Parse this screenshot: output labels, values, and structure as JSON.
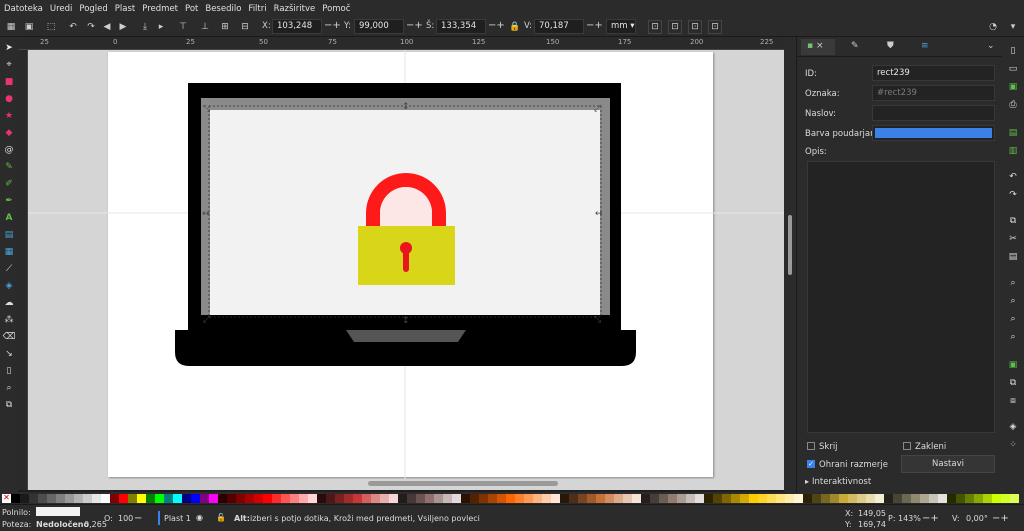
{
  "menu": [
    "Datoteka",
    "Uredi",
    "Pogled",
    "Plast",
    "Predmet",
    "Pot",
    "Besedilo",
    "Filtri",
    "Razširitve",
    "Pomoč"
  ],
  "coords": {
    "x_label": "X:",
    "x_value": "103,248",
    "y_label": "Y:",
    "y_value": "99,000",
    "w_label": "Š:",
    "w_value": "133,354",
    "h_label": "V:",
    "h_value": "70,187",
    "unit": "mm"
  },
  "ruler_marks": [
    "25",
    "0",
    "25",
    "50",
    "75",
    "100",
    "125",
    "150",
    "175",
    "200",
    "225"
  ],
  "panel": {
    "id_label": "ID:",
    "id_value": "rect239",
    "label_label": "Oznaka:",
    "label_placeholder": "#rect239",
    "title_label": "Naslov:",
    "title_value": "",
    "highlight_label": "Barva poudarjanja:",
    "highlight_color": "#3b82e8",
    "desc_label": "Opis:",
    "hide_label": "Skrij",
    "lock_label": "Zakleni",
    "keep_ratio_label": "Ohrani razmerje",
    "set_button": "Nastavi",
    "interactivity_label": "Interaktivnost"
  },
  "status": {
    "fill_label": "Polnilo:",
    "stroke_label": "Poteza:",
    "stroke_value": "Nedoločeno",
    "stroke_width": "0,265",
    "opacity_label": "O:",
    "opacity_value": "100",
    "layer": "Plast 1",
    "message_bold": "Alt:",
    "message": " izberi s potjo dotika, Kroži med predmeti, Vsiljeno povleci",
    "x_label": "X:",
    "x_value": "149,05",
    "y_label": "Y:",
    "y_value": "169,74",
    "zoom_label": "P:",
    "zoom_value": "143%",
    "rot_label": "V:",
    "rot_value": "0,00°"
  },
  "colors": {
    "laptop": "#000000",
    "screen_bezel": "#8a8a8a",
    "screen": "#f2f2f2",
    "shackle": "#ff1a1a",
    "lock_body": "#d9d61a",
    "keyhole": "#e8161c",
    "trackpad": "#555555"
  },
  "palette": [
    "#000000",
    "#1a1a1a",
    "#333333",
    "#4d4d4d",
    "#666666",
    "#808080",
    "#999999",
    "#b3b3b3",
    "#cccccc",
    "#e6e6e6",
    "#ffffff",
    "#800000",
    "#ff0000",
    "#808000",
    "#ffff00",
    "#008000",
    "#00ff00",
    "#008080",
    "#00ffff",
    "#000080",
    "#0000ff",
    "#800080",
    "#ff00ff",
    "#2b0000",
    "#550000",
    "#800000",
    "#aa0000",
    "#d40000",
    "#ff0000",
    "#ff2a2a",
    "#ff5555",
    "#ff8080",
    "#ffaaaa",
    "#ffd5d5",
    "#280b0b",
    "#501616",
    "#782121",
    "#a02c2c",
    "#c83737",
    "#d35f5f",
    "#de8787",
    "#e9afaf",
    "#f4d7d7",
    "#241c1c",
    "#483737",
    "#6c5353",
    "#916f6f",
    "#ac9393",
    "#c8b7b7",
    "#e3dbdb",
    "#2b1100",
    "#552200",
    "#803300",
    "#aa4400",
    "#d45500",
    "#ff6600",
    "#ff7f2a",
    "#ff9955",
    "#ffb380",
    "#ffccaa",
    "#ffe6d5",
    "#28170b",
    "#502d16",
    "#784421",
    "#a05a2c",
    "#c87137",
    "#d38d5f",
    "#deaa87",
    "#e9c6af",
    "#f4e3d7",
    "#241f1c",
    "#483e37",
    "#6c5d53",
    "#917c6f",
    "#ac9d93",
    "#c8beb7",
    "#e3dedb",
    "#2b2200",
    "#554400",
    "#806600",
    "#aa8800",
    "#d4aa00",
    "#ffcc00",
    "#ffd42a",
    "#ffdd55",
    "#ffe680",
    "#ffeeaa",
    "#fff6d5",
    "#28220b",
    "#504416",
    "#786721",
    "#a0892c",
    "#c8ab37",
    "#d3bc5f",
    "#decd87",
    "#e9ddaf",
    "#f4eed7",
    "#24221c",
    "#484537",
    "#6c6753",
    "#91896f",
    "#aca793",
    "#c8c4b7",
    "#e3e2db",
    "#222b00",
    "#445500",
    "#668000",
    "#88aa00",
    "#aad400",
    "#ccff00",
    "#d4ff2a",
    "#ddff55"
  ]
}
